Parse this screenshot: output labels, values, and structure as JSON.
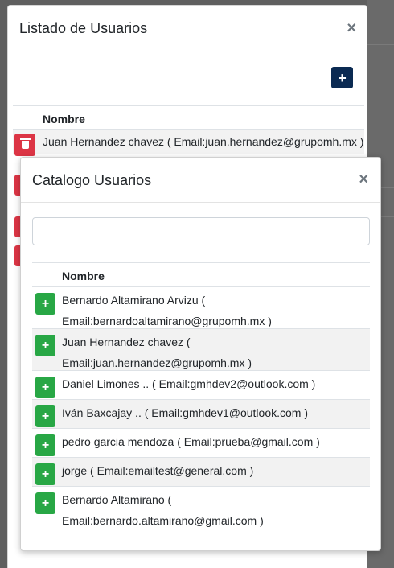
{
  "outer_modal": {
    "title": "Listado de Usuarios",
    "close_glyph": "×",
    "add_glyph": "+",
    "table_header": "Nombre",
    "rows": [
      "Juan Hernandez chavez ( Email:juan.hernandez@grupomh.mx )"
    ]
  },
  "inner_modal": {
    "title": "Catalogo Usuarios",
    "close_glyph": "×",
    "search_value": "",
    "table_header": "Nombre",
    "add_glyph": "+",
    "rows": [
      {
        "line1": "Bernardo Altamirano Arvizu (",
        "line2": "Email:bernardoaltamirano@grupomh.mx )"
      },
      {
        "line1": "Juan Hernandez chavez (",
        "line2": "Email:juan.hernandez@grupomh.mx )"
      },
      {
        "line1": "Daniel Limones .. ( Email:gmhdev2@outlook.com )",
        "line2": ""
      },
      {
        "line1": "Iván Baxcajay .. ( Email:gmhdev1@outlook.com )",
        "line2": ""
      },
      {
        "line1": "pedro garcia mendoza ( Email:prueba@gmail.com )",
        "line2": ""
      },
      {
        "line1": "jorge ( Email:emailtest@general.com )",
        "line2": ""
      },
      {
        "line1": "Bernardo Altamirano (",
        "line2": "Email:bernardo.altamirano@gmail.com )"
      }
    ]
  },
  "colors": {
    "add_primary": "#0b2a52",
    "add_success": "#28a745",
    "delete_danger": "#dc3545"
  },
  "icons": {
    "delete": "trash-icon",
    "add": "plus-icon",
    "close": "close-icon"
  }
}
